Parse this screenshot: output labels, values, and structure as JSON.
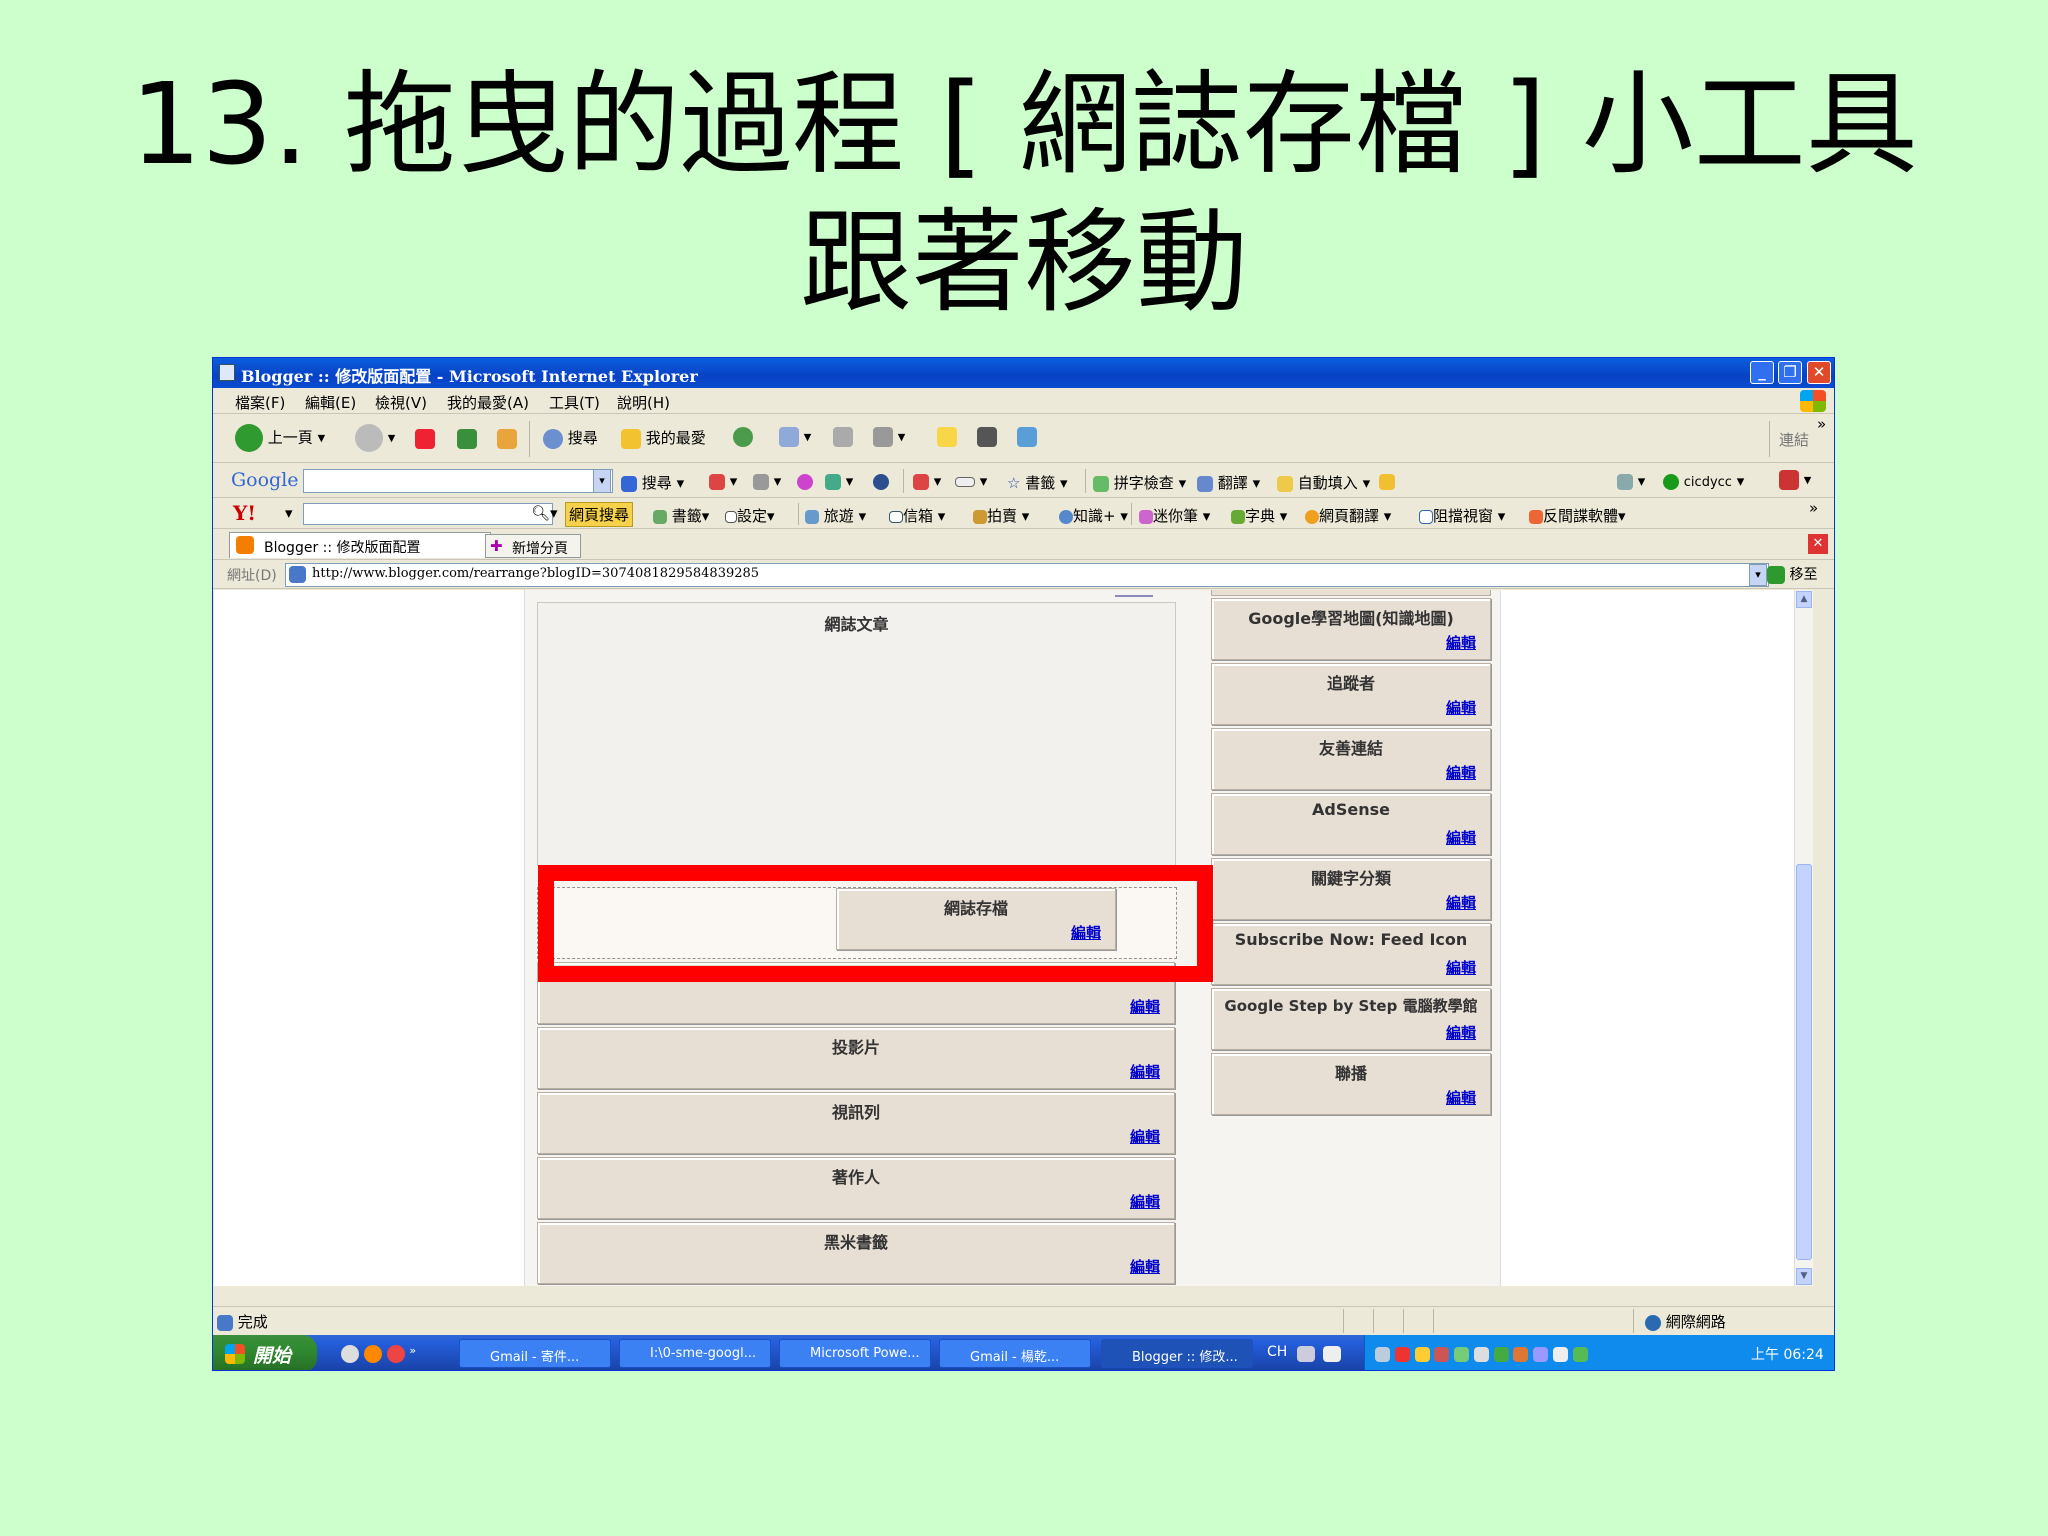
{
  "slide": {
    "title_line1": "13. 拖曳的過程 [ 網誌存檔 ] 小工具",
    "title_line2": "跟著移動"
  },
  "window": {
    "title": "Blogger :: 修改版面配置 - Microsoft Internet Explorer",
    "minimize": "_",
    "restore": "❐",
    "close": "✕"
  },
  "menu": [
    "檔案(F)",
    "編輯(E)",
    "檢視(V)",
    "我的最愛(A)",
    "工具(T)",
    "說明(H)"
  ],
  "standard_toolbar": {
    "back": "上一頁",
    "search": "搜尋",
    "favorites": "我的最愛",
    "links": "連結",
    "more": "»"
  },
  "google_toolbar": {
    "logo": "Google",
    "search": "搜尋",
    "bookmarks": "書籤",
    "spellcheck": "拼字檢查",
    "translate": "翻譯",
    "autofill": "自動填入",
    "account": "cicdycc"
  },
  "yahoo_toolbar": {
    "logo": "Y!",
    "web_search": "網頁搜尋",
    "bookmarks": "書籤",
    "settings": "設定",
    "travel": "旅遊",
    "mail": "信箱",
    "auction": "拍賣",
    "knowledge": "知識+",
    "mini_pen": "迷你筆",
    "dictionary": "字典",
    "page_translate": "網頁翻譯",
    "popup_block": "阻擋視窗",
    "anti_spyware": "反間諜軟體",
    "more": "»"
  },
  "tabs": {
    "active_tab": "Blogger :: 修改版面配置",
    "new_tab": "新增分頁"
  },
  "address_bar": {
    "label": "網址(D)",
    "url": "http://www.blogger.com/rearrange?blogID=3074081829584839285",
    "go": "移至"
  },
  "layout": {
    "main_widget": "網誌文章",
    "dragging_widget": {
      "title": "網誌存檔",
      "edit": "編輯"
    },
    "partial_edit_top": "編輯",
    "left_widgets": [
      {
        "title": "",
        "edit": "編輯"
      },
      {
        "title": "投影片",
        "edit": "編輯"
      },
      {
        "title": "視訊列",
        "edit": "編輯"
      },
      {
        "title": "著作人",
        "edit": "編輯"
      },
      {
        "title": "黑米書籤",
        "edit": "編輯"
      }
    ],
    "right_widgets": [
      {
        "title": "Google學習地圖(知識地圖)",
        "edit": "編輯"
      },
      {
        "title": "追蹤者",
        "edit": "編輯"
      },
      {
        "title": "友善連結",
        "edit": "編輯"
      },
      {
        "title": "AdSense",
        "edit": "編輯"
      },
      {
        "title": "關鍵字分類",
        "edit": "編輯"
      },
      {
        "title": "Subscribe Now: Feed Icon",
        "edit": "編輯"
      },
      {
        "title": "Google Step by Step 電腦教學館",
        "edit": "編輯"
      },
      {
        "title": "聯播",
        "edit": "編輯"
      }
    ]
  },
  "status_bar": {
    "status": "完成",
    "zone": "網際網路"
  },
  "taskbar": {
    "start": "開始",
    "buttons": [
      "Gmail - 寄件...",
      "I:\\0-sme-googl...",
      "Microsoft Powe...",
      "Gmail - 楊乾...",
      "Blogger :: 修改..."
    ],
    "lang": "CH",
    "clock": "上午 06:24"
  },
  "colors": {
    "slide_bg": "#ccffcc",
    "highlight": "#ff0000",
    "title_bar": "#0842c4"
  }
}
